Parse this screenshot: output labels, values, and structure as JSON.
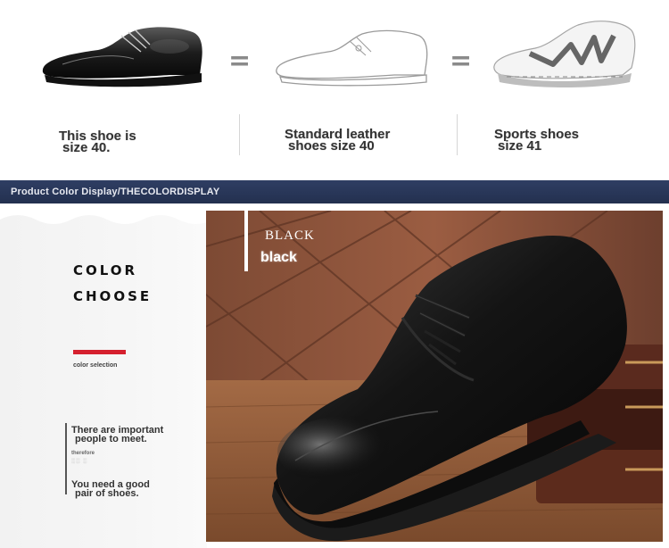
{
  "size_compare": {
    "equals_sign": "=",
    "items": [
      {
        "name": "dress-shoe",
        "caption_line1": "This shoe is",
        "caption_line2": "size 40."
      },
      {
        "name": "outline-leather-shoe",
        "caption_line1": "Standard leather",
        "caption_line2": "shoes size 40"
      },
      {
        "name": "sports-shoe",
        "caption_line1": "Sports shoes",
        "caption_line2": "size 41"
      }
    ]
  },
  "section_bar": {
    "text": "Product Color Display/THECOLORDISPLAY"
  },
  "left_panel": {
    "title_line1": "COLOR",
    "title_line2": "CHOOSE",
    "subtitle": "color selection",
    "accent_color": "#d5202e",
    "quote_line1": "There are important",
    "quote_line2": "people to meet.",
    "quote_mid": "therefore",
    "quote_line3": "You need a good",
    "quote_line4": "pair of shoes."
  },
  "photo": {
    "label_top": "BLACK",
    "label_bottom": "black"
  },
  "colors": {
    "bar_navy": "#2b3a5e",
    "accent_red": "#d5202e"
  }
}
